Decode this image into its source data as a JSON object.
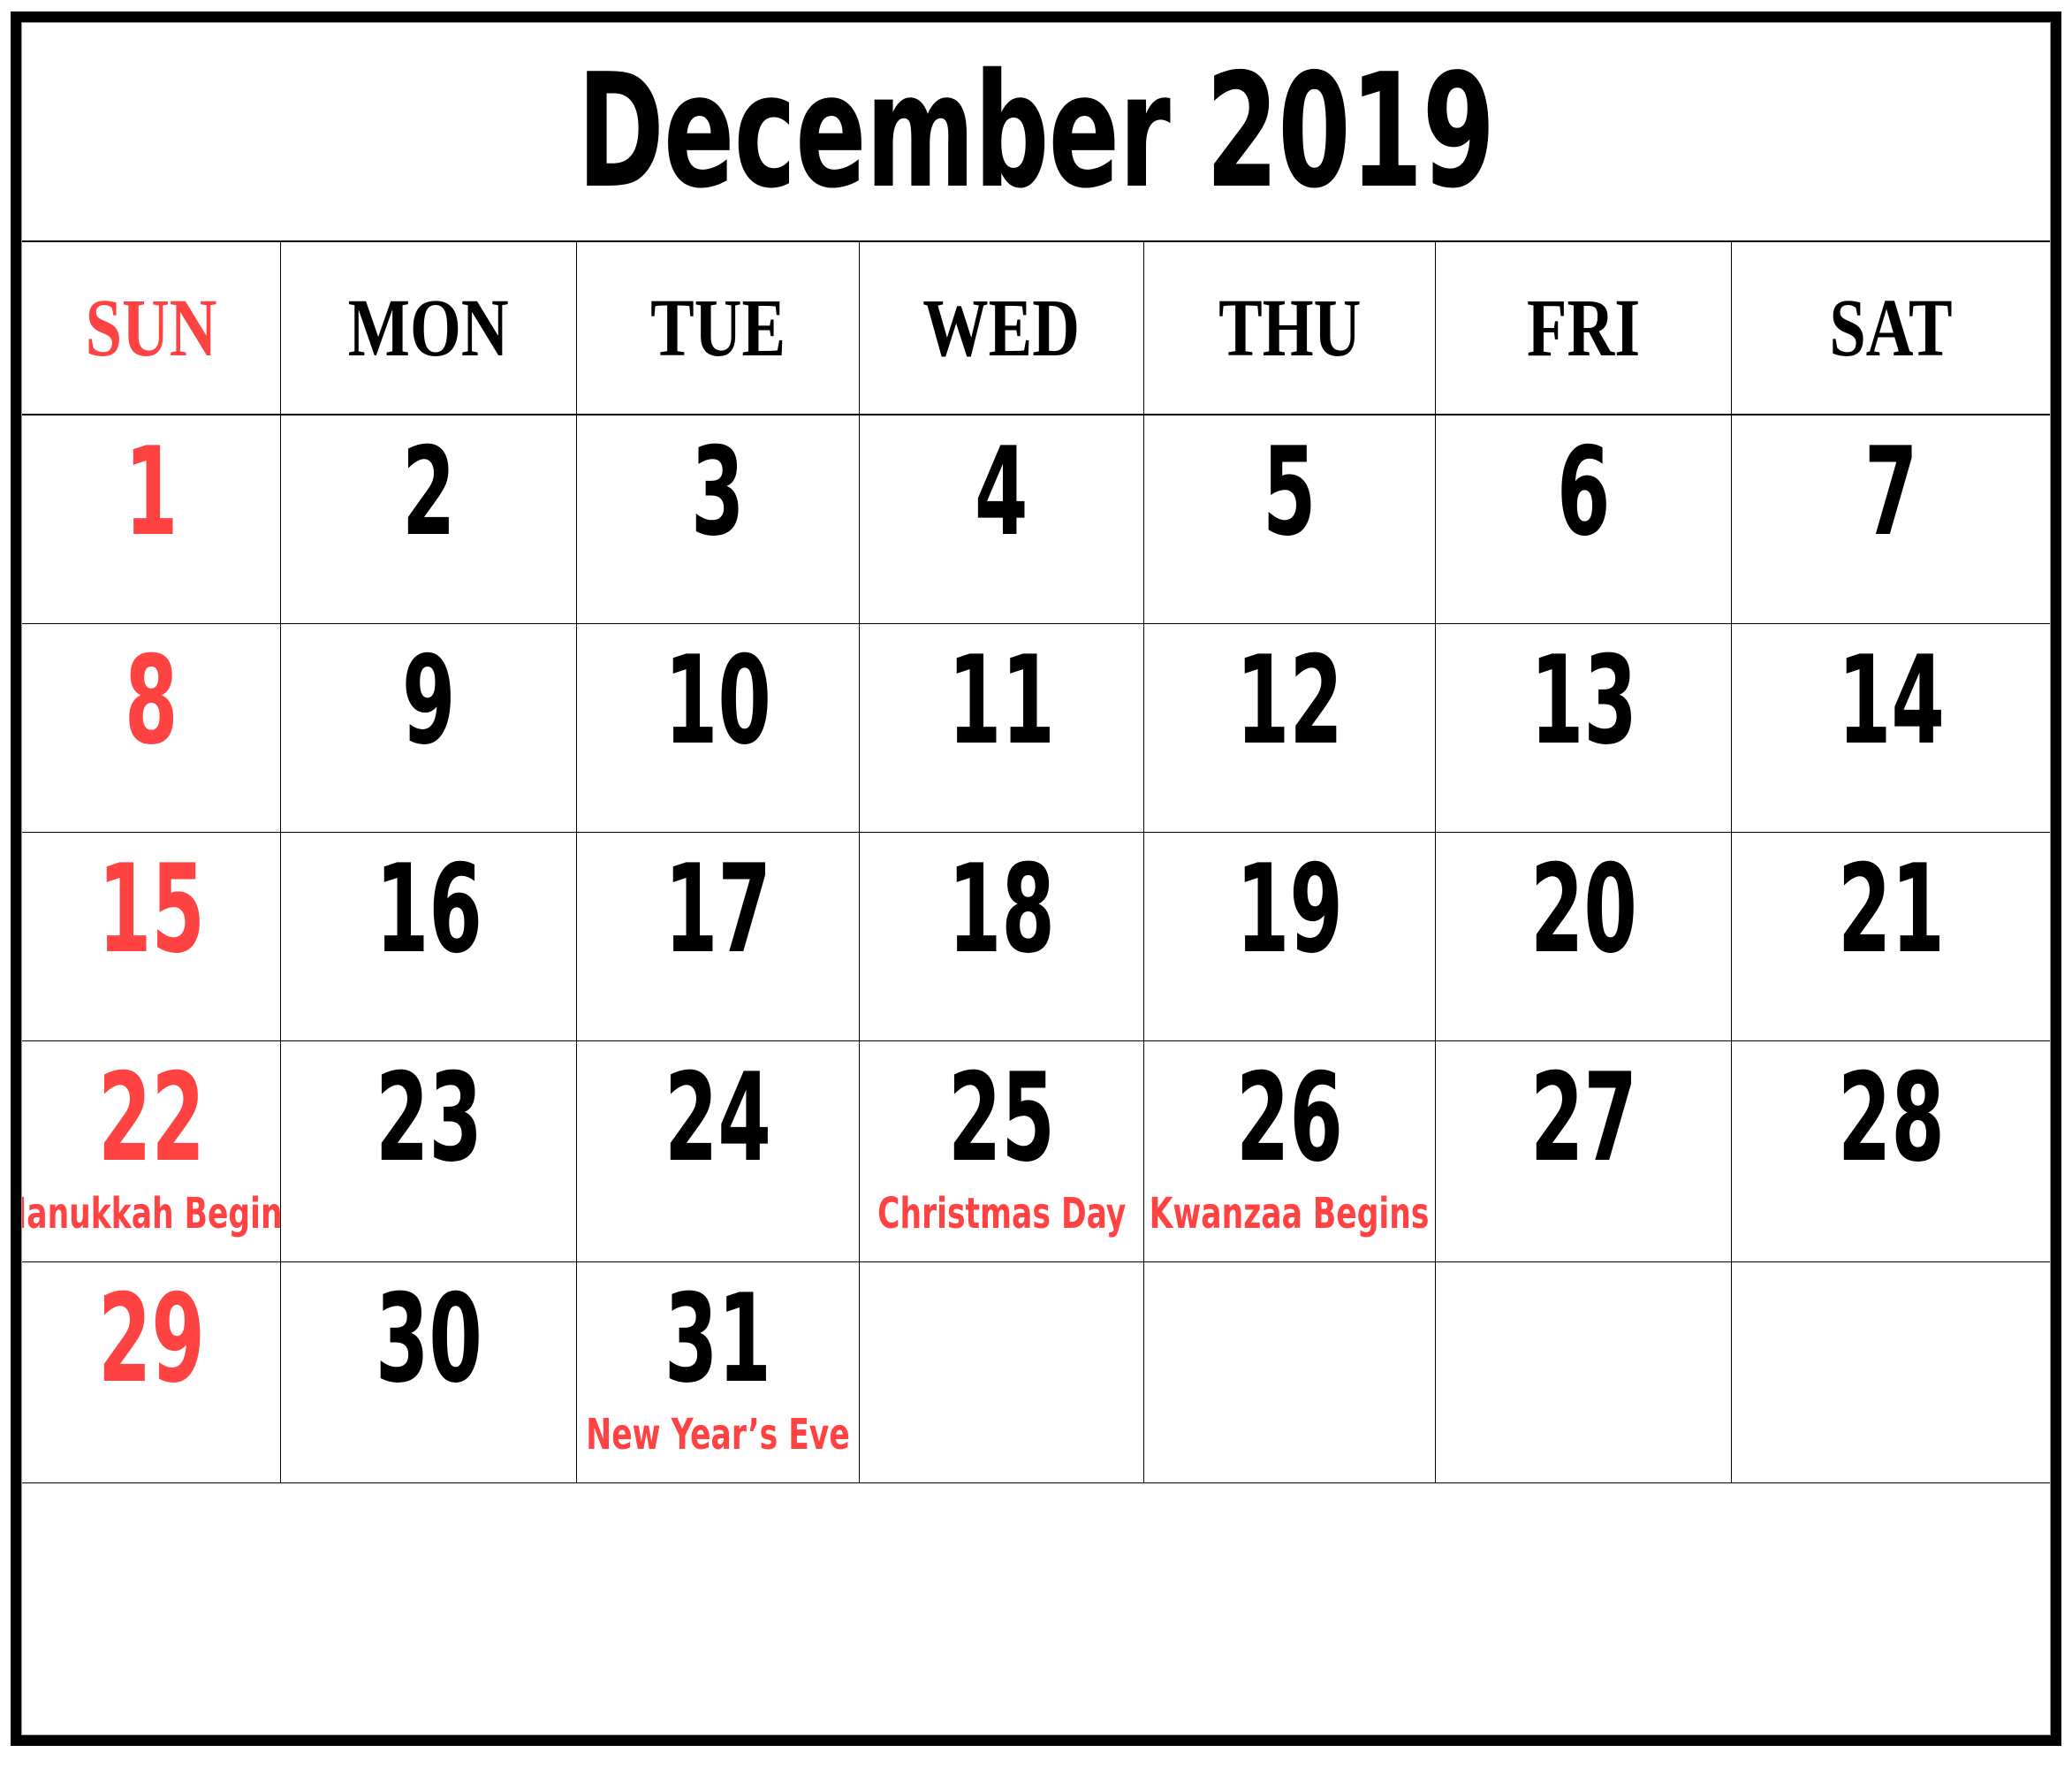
{
  "calendar": {
    "title": "December 2019",
    "month": "December",
    "year": "2019",
    "accent_red": "#ff4242",
    "text_black": "#000000",
    "background": "#ffffff",
    "weekday_headers": [
      {
        "label": "SUN",
        "highlight": true
      },
      {
        "label": "MON",
        "highlight": false
      },
      {
        "label": "TUE",
        "highlight": false
      },
      {
        "label": "WED",
        "highlight": false
      },
      {
        "label": "THU",
        "highlight": false
      },
      {
        "label": "FRI",
        "highlight": false
      },
      {
        "label": "SAT",
        "highlight": false
      }
    ],
    "weeks": [
      [
        {
          "date": "1",
          "sunday": true,
          "event": ""
        },
        {
          "date": "2",
          "sunday": false,
          "event": ""
        },
        {
          "date": "3",
          "sunday": false,
          "event": ""
        },
        {
          "date": "4",
          "sunday": false,
          "event": ""
        },
        {
          "date": "5",
          "sunday": false,
          "event": ""
        },
        {
          "date": "6",
          "sunday": false,
          "event": ""
        },
        {
          "date": "7",
          "sunday": false,
          "event": ""
        }
      ],
      [
        {
          "date": "8",
          "sunday": true,
          "event": ""
        },
        {
          "date": "9",
          "sunday": false,
          "event": ""
        },
        {
          "date": "10",
          "sunday": false,
          "event": ""
        },
        {
          "date": "11",
          "sunday": false,
          "event": ""
        },
        {
          "date": "12",
          "sunday": false,
          "event": ""
        },
        {
          "date": "13",
          "sunday": false,
          "event": ""
        },
        {
          "date": "14",
          "sunday": false,
          "event": ""
        }
      ],
      [
        {
          "date": "15",
          "sunday": true,
          "event": ""
        },
        {
          "date": "16",
          "sunday": false,
          "event": ""
        },
        {
          "date": "17",
          "sunday": false,
          "event": ""
        },
        {
          "date": "18",
          "sunday": false,
          "event": ""
        },
        {
          "date": "19",
          "sunday": false,
          "event": ""
        },
        {
          "date": "20",
          "sunday": false,
          "event": ""
        },
        {
          "date": "21",
          "sunday": false,
          "event": ""
        }
      ],
      [
        {
          "date": "22",
          "sunday": true,
          "event": "Hanukkah Begins"
        },
        {
          "date": "23",
          "sunday": false,
          "event": ""
        },
        {
          "date": "24",
          "sunday": false,
          "event": ""
        },
        {
          "date": "25",
          "sunday": false,
          "event": "Christmas Day"
        },
        {
          "date": "26",
          "sunday": false,
          "event": "Kwanzaa Begins"
        },
        {
          "date": "27",
          "sunday": false,
          "event": ""
        },
        {
          "date": "28",
          "sunday": false,
          "event": ""
        }
      ],
      [
        {
          "date": "29",
          "sunday": true,
          "event": ""
        },
        {
          "date": "30",
          "sunday": false,
          "event": ""
        },
        {
          "date": "31",
          "sunday": false,
          "event": "New Year’s Eve"
        },
        {
          "date": "",
          "sunday": false,
          "event": ""
        },
        {
          "date": "",
          "sunday": false,
          "event": ""
        },
        {
          "date": "",
          "sunday": false,
          "event": ""
        },
        {
          "date": "",
          "sunday": false,
          "event": ""
        }
      ]
    ],
    "notes_row": {
      "label": ""
    }
  }
}
